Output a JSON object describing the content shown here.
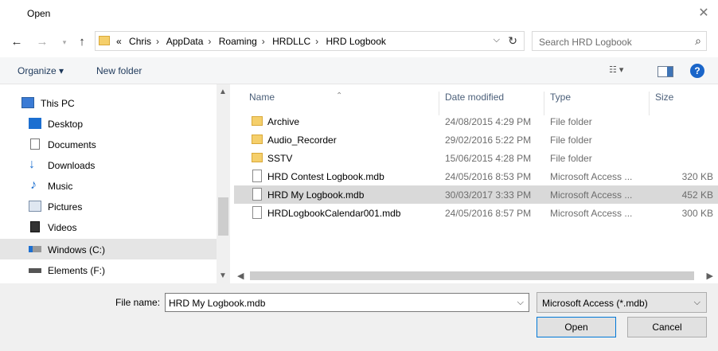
{
  "window": {
    "title": "Open"
  },
  "address": {
    "overflow": "«",
    "crumbs": [
      "Chris",
      "AppData",
      "Roaming",
      "HRDLLC",
      "HRD Logbook"
    ],
    "separator": "›"
  },
  "search": {
    "placeholder": "Search HRD Logbook"
  },
  "toolbar": {
    "organize_label": "Organize ▾",
    "new_folder_label": "New folder",
    "views_label": "☷ ▾",
    "help_label": "?"
  },
  "sidebar": {
    "items": [
      {
        "label": "This PC",
        "icon": "pc-icon"
      },
      {
        "label": "Desktop",
        "icon": "desktop-icon"
      },
      {
        "label": "Documents",
        "icon": "documents-icon"
      },
      {
        "label": "Downloads",
        "icon": "downloads-icon"
      },
      {
        "label": "Music",
        "icon": "music-icon"
      },
      {
        "label": "Pictures",
        "icon": "pictures-icon"
      },
      {
        "label": "Videos",
        "icon": "videos-icon"
      },
      {
        "label": "Windows (C:)",
        "icon": "drive-c-icon",
        "selected": true
      },
      {
        "label": "Elements (F:)",
        "icon": "drive-icon"
      }
    ]
  },
  "columns": {
    "name": "Name",
    "date": "Date modified",
    "type": "Type",
    "size": "Size"
  },
  "files": [
    {
      "name": "Archive",
      "date": "24/08/2015 4:29 PM",
      "type": "File folder",
      "size": "",
      "kind": "folder"
    },
    {
      "name": "Audio_Recorder",
      "date": "29/02/2016 5:22 PM",
      "type": "File folder",
      "size": "",
      "kind": "folder"
    },
    {
      "name": "SSTV",
      "date": "15/06/2015 4:28 PM",
      "type": "File folder",
      "size": "",
      "kind": "folder"
    },
    {
      "name": "HRD Contest Logbook.mdb",
      "date": "24/05/2016 8:53 PM",
      "type": "Microsoft Access ...",
      "size": "320 KB",
      "kind": "file"
    },
    {
      "name": "HRD My Logbook.mdb",
      "date": "30/03/2017 3:33 PM",
      "type": "Microsoft Access ...",
      "size": "452 KB",
      "kind": "file",
      "selected": true
    },
    {
      "name": "HRDLogbookCalendar001.mdb",
      "date": "24/05/2016 8:57 PM",
      "type": "Microsoft Access ...",
      "size": "300 KB",
      "kind": "file"
    }
  ],
  "footer": {
    "filename_label": "File name:",
    "filename_value": "HRD My Logbook.mdb",
    "filter_value": "Microsoft Access (*.mdb)",
    "open_label": "Open",
    "cancel_label": "Cancel"
  },
  "colors": {
    "folder": "#f5cf6b",
    "selection": "#d9d9d9",
    "accent": "#0078d7"
  }
}
